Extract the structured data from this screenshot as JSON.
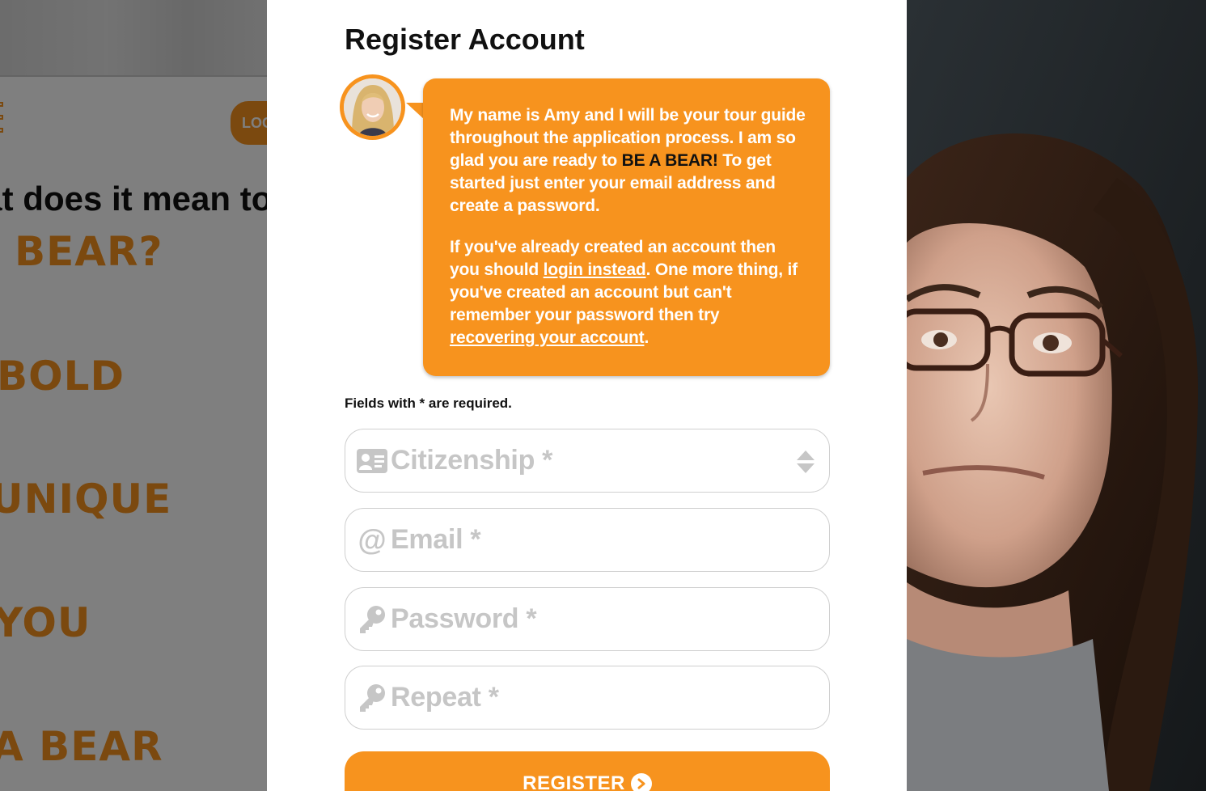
{
  "background_page": {
    "login_label": "LOG",
    "heading": "What does it mean to",
    "words": [
      "BEAR?",
      "BOLD",
      "UNIQUE",
      "YOU",
      "A BEAR"
    ]
  },
  "modal": {
    "title": "Register Account",
    "guide": {
      "avatar": "guide-avatar",
      "p1_a": "My name is Amy and I will be your tour guide throughout the application process. I am so glad you are ready to ",
      "p1_em": "BE A BEAR!",
      "p1_b": " To get started just enter your email address and create a password.",
      "p2_a": "If you've already created an account then you should ",
      "p2_link1": "login instead",
      "p2_b": ". One more thing, if you've created an account but can't remember your password then try ",
      "p2_link2": "recovering your account",
      "p2_c": "."
    },
    "required_note": "Fields with * are required.",
    "fields": {
      "citizenship": {
        "placeholder": "Citizenship *",
        "icon": "id-card-icon"
      },
      "email": {
        "placeholder": "Email *",
        "icon": "at-sign-icon",
        "icon_glyph": "@"
      },
      "password": {
        "placeholder": "Password *",
        "icon": "key-icon"
      },
      "repeat": {
        "placeholder": "Repeat *",
        "icon": "key-icon"
      }
    },
    "register_label": "REGISTER"
  },
  "colors": {
    "accent": "#f7931e",
    "text": "#111111",
    "placeholder": "#c6c6c6"
  }
}
